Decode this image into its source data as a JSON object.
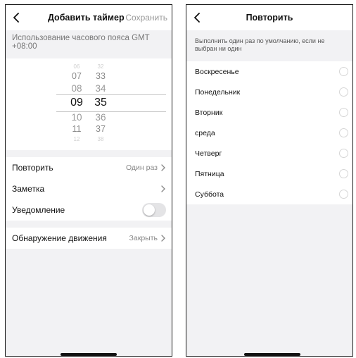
{
  "add_timer": {
    "title": "Добавить таймер",
    "save_label": "Сохранить",
    "timezone_text": "Использование часового пояса GMT +08:00",
    "picker": {
      "hours": [
        "06",
        "07",
        "08",
        "09",
        "10",
        "11",
        "12"
      ],
      "minutes": [
        "32",
        "33",
        "34",
        "35",
        "36",
        "37",
        "38"
      ],
      "selected_hour": "09",
      "selected_minute": "35"
    },
    "repeat": {
      "label": "Повторить",
      "value": "Один раз"
    },
    "note": {
      "label": "Заметка"
    },
    "notification": {
      "label": "Уведомление",
      "enabled": false
    },
    "motion": {
      "label": "Обнаружение движения",
      "value": "Закрыть"
    }
  },
  "repeat_screen": {
    "title": "Повторить",
    "hint": "Выполнить один раз по умолчанию, если не выбран ни один",
    "days": [
      {
        "label": "Воскресенье",
        "selected": false
      },
      {
        "label": "Понедельник",
        "selected": false
      },
      {
        "label": "Вторник",
        "selected": false
      },
      {
        "label": "среда",
        "selected": false
      },
      {
        "label": "Четверг",
        "selected": false
      },
      {
        "label": "Пятница",
        "selected": false
      },
      {
        "label": "Суббота",
        "selected": false
      }
    ]
  }
}
